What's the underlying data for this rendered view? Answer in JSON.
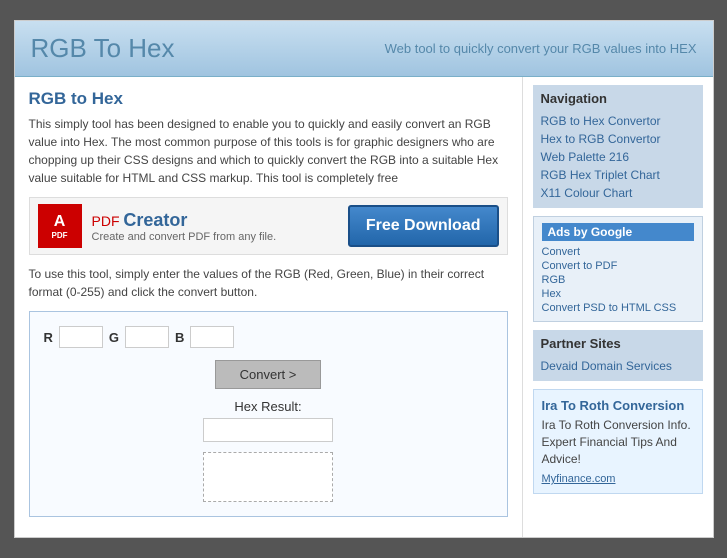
{
  "header": {
    "title": "RGB To Hex",
    "tagline": "Web tool to quickly convert your RGB values into HEX"
  },
  "main": {
    "page_heading": "RGB to Hex",
    "description": "This simply tool has been designed to enable you to quickly and easily convert an RGB value into Hex. The most common purpose of this tools is for graphic designers who are chopping up their CSS designs and which to quickly convert the RGB into a suitable Hex value suitable for HTML and CSS markup. This tool is completely free",
    "ad": {
      "pdf_icon_text": "PDF",
      "creator_name": "PDF",
      "creator_name2": "Creator",
      "creator_sub": "Create and convert PDF from any file.",
      "free_download": "Free Download"
    },
    "instructions": "To use this tool, simply enter the values of the RGB (Red, Green, Blue) in their correct format (0-255) and click the convert button.",
    "converter": {
      "r_label": "R",
      "g_label": "G",
      "b_label": "B",
      "convert_btn": "Convert >",
      "hex_result_label": "Hex Result:"
    }
  },
  "sidebar": {
    "nav_title": "Navigation",
    "nav_links": [
      "RGB to Hex Convertor",
      "Hex to RGB Convertor",
      "Web Palette 216",
      "RGB Hex Triplet Chart",
      "X11 Colour Chart"
    ],
    "ads_title": "Ads by Google",
    "ads_links": [
      "Convert",
      "Convert to PDF",
      "RGB",
      "Hex",
      "Convert PSD to HTML CSS"
    ],
    "partner_title": "Partner Sites",
    "partner_link": "Devaid Domain Services",
    "roth": {
      "title": "Ira To Roth Conversion",
      "desc": "Ira To Roth Conversion Info. Expert Financial Tips And Advice!",
      "link": "Myfinance.com"
    }
  }
}
